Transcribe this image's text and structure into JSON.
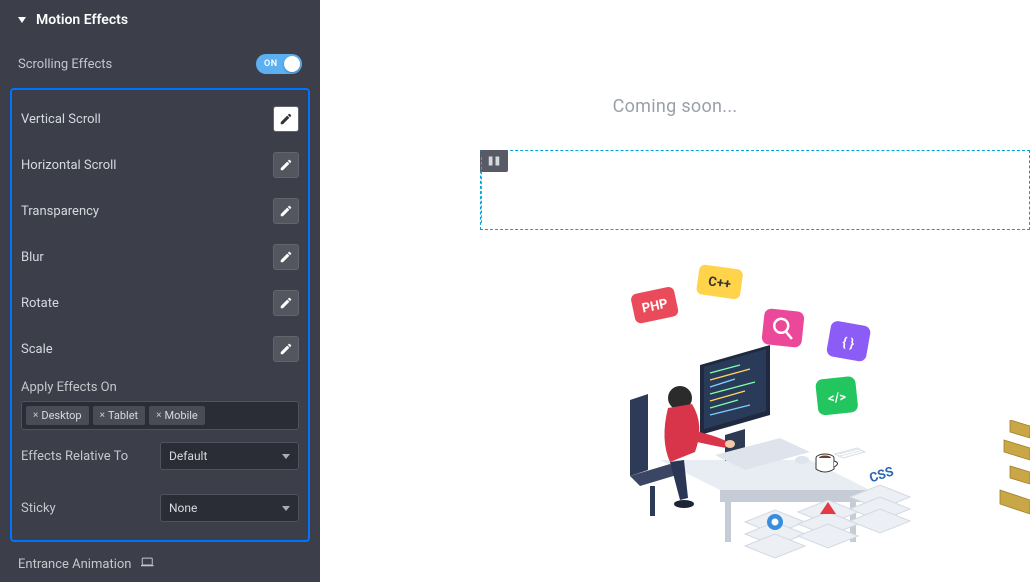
{
  "section": {
    "title": "Motion Effects"
  },
  "scrolling": {
    "label": "Scrolling Effects",
    "on_text": "ON"
  },
  "effects": [
    {
      "label": "Vertical Scroll",
      "highlighted": true
    },
    {
      "label": "Horizontal Scroll",
      "highlighted": false
    },
    {
      "label": "Transparency",
      "highlighted": false
    },
    {
      "label": "Blur",
      "highlighted": false
    },
    {
      "label": "Rotate",
      "highlighted": false
    },
    {
      "label": "Scale",
      "highlighted": false
    }
  ],
  "applyOn": {
    "label": "Apply Effects On",
    "chips": [
      "Desktop",
      "Tablet",
      "Mobile"
    ]
  },
  "relative": {
    "label": "Effects Relative To",
    "value": "Default"
  },
  "sticky": {
    "label": "Sticky",
    "value": "None"
  },
  "entrance": {
    "label": "Entrance Animation"
  },
  "canvas": {
    "heading": "Coming soon...",
    "badges": {
      "php": "PHP",
      "cpp": "C++",
      "css": "CSS",
      "code": "</>",
      "brace": "{ }"
    }
  }
}
